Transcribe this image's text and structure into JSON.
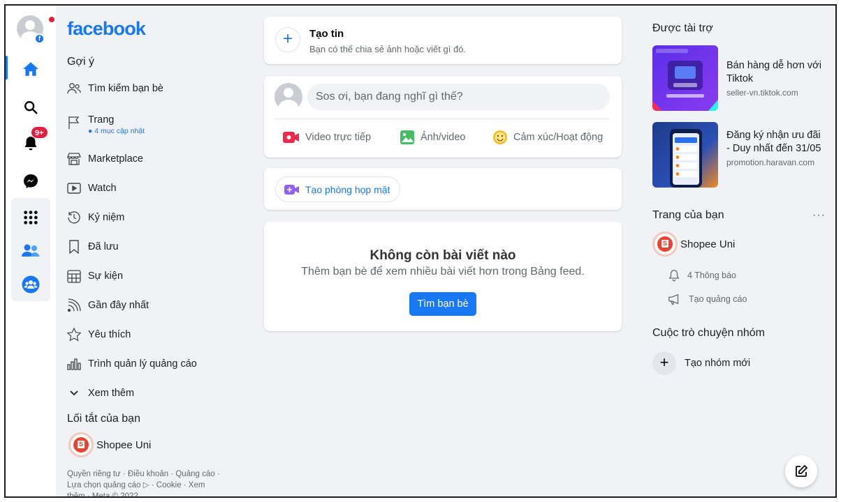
{
  "brand": {
    "logo_text": "facebook",
    "primary_color": "#1877f2"
  },
  "rail": {
    "notifications_badge": "9+"
  },
  "leftnav": {
    "suggestions_title": "Gợi ý",
    "items": [
      {
        "label": "Tìm kiếm bạn bè",
        "icon": "friends-icon"
      },
      {
        "label": "Trang",
        "sub": "● 4 mục cập nhật",
        "icon": "flag-icon"
      },
      {
        "label": "Marketplace",
        "icon": "shop-icon"
      },
      {
        "label": "Watch",
        "icon": "watch-icon"
      },
      {
        "label": "Kỷ niệm",
        "icon": "memories-icon"
      },
      {
        "label": "Đã lưu",
        "icon": "bookmark-icon"
      },
      {
        "label": "Sự kiện",
        "icon": "calendar-icon"
      },
      {
        "label": "Gần đây nhất",
        "icon": "feed-icon"
      },
      {
        "label": "Yêu thích",
        "icon": "star-icon"
      },
      {
        "label": "Trình quản lý quảng cáo",
        "icon": "chart-icon"
      },
      {
        "label": "Xem thêm",
        "icon": "chevron-down-icon"
      }
    ],
    "shortcuts_title": "Lối tắt của bạn",
    "shortcut": {
      "label": "Shopee Uni"
    },
    "footer_line1": "Quyền riêng tư · Điều khoản · Quảng cáo ·",
    "footer_line2": "Lựa chọn quảng cáo ▷ · Cookie · Xem",
    "footer_line3": "thêm · Meta © 2022"
  },
  "center": {
    "create_story": {
      "title": "Tạo tin",
      "subtitle": "Bạn có thể chia sẻ ảnh hoặc viết gì đó."
    },
    "composer": {
      "placeholder": "Sos ơi, bạn đang nghĩ gì thế?",
      "actions": {
        "live": "Video trực tiếp",
        "photo": "Ảnh/video",
        "feeling": "Cảm xúc/Hoạt động"
      }
    },
    "room_button": "Tạo phòng họp mặt",
    "empty": {
      "title": "Không còn bài viết nào",
      "subtitle": "Thêm bạn bè để xem nhiều bài viết hơn trong Bảng feed.",
      "button": "Tìm bạn bè"
    }
  },
  "right": {
    "sponsored_title": "Được tài trợ",
    "ads": [
      {
        "headline": "Bán hàng dễ hơn với Tiktok",
        "url": "seller-vn.tiktok.com"
      },
      {
        "headline": "Đăng ký nhận ưu đãi - Duy nhất đến 31/05",
        "url": "promotion.haravan.com"
      }
    ],
    "your_pages_title": "Trang của bạn",
    "page_name": "Shopee Uni",
    "notifications": "4 Thông báo",
    "create_ad": "Tạo quảng cáo",
    "group_chats_title": "Cuộc trò chuyện nhóm",
    "new_group": "Tạo nhóm mới"
  }
}
